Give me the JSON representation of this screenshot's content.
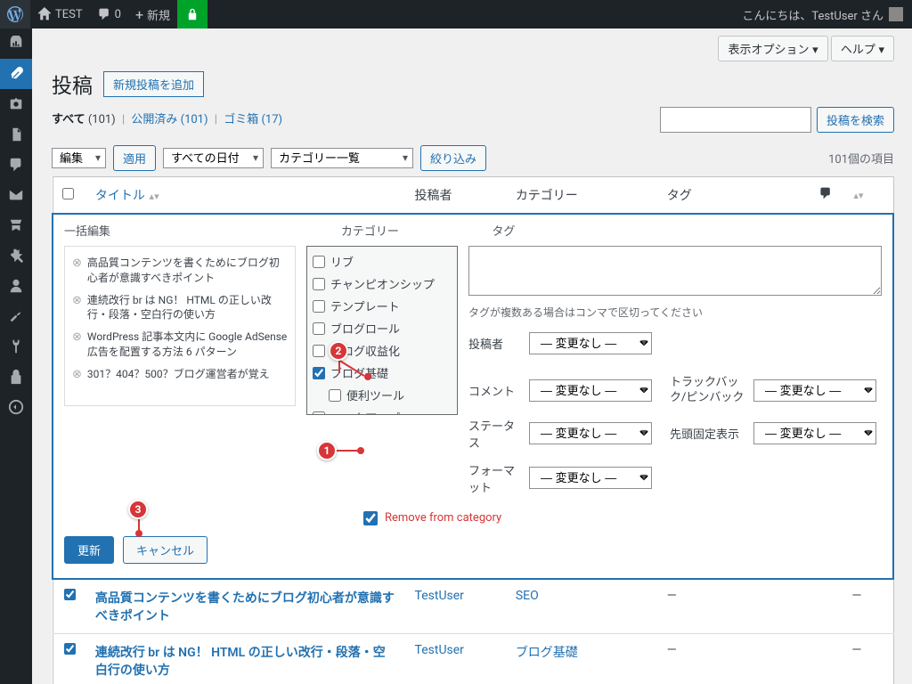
{
  "adminbar": {
    "site_name": "TEST",
    "comment_count": "0",
    "new_label": "新規",
    "greeting": "こんにちは、TestUser さん"
  },
  "top_options": {
    "screen_options": "表示オプション ▾",
    "help": "ヘルプ ▾"
  },
  "header": {
    "page_title": "投稿",
    "add_new": "新規投稿を追加"
  },
  "views": {
    "all_label": "すべて",
    "all_count": "(101)",
    "published_label": "公開済み",
    "published_count": "(101)",
    "trash_label": "ゴミ箱",
    "trash_count": "(17)"
  },
  "search": {
    "placeholder": "",
    "button": "投稿を検索"
  },
  "filters": {
    "bulk_action_select": "編集",
    "apply": "適用",
    "date_select": "すべての日付",
    "cat_select": "カテゴリー一覧",
    "filter": "絞り込み",
    "item_count": "101個の項目"
  },
  "columns": {
    "title": "タイトル",
    "author": "投稿者",
    "categories": "カテゴリー",
    "tags": "タグ"
  },
  "bulk_edit": {
    "header": "一括編集",
    "categories_label": "カテゴリー",
    "tags_label": "タグ",
    "tags_help": "タグが複数ある場合はコンマで区切ってください",
    "author_label": "投稿者",
    "comment_label": "コメント",
    "trackback_label": "トラックバック/ピンバック",
    "status_label": "ステータス",
    "sticky_label": "先頭固定表示",
    "format_label": "フォーマット",
    "no_change": "— 変更なし —",
    "remove_from_category": "Remove from category",
    "update": "更新",
    "cancel": "キャンセル",
    "titles": [
      "高品質コンテンツを書くためにブログ初心者が意識すべきポイント",
      "連続改行 br は NG！ HTML の正しい改行・段落・空白行の使い方",
      "WordPress 記事本文内に Google AdSense 広告を配置する方法 6 パターン",
      "301？404？500？ブログ運営者が覚え"
    ],
    "categories": [
      {
        "label": "リブ",
        "checked": false,
        "indent": false
      },
      {
        "label": "チャンピオンシップ",
        "checked": false,
        "indent": false
      },
      {
        "label": "テンプレート",
        "checked": false,
        "indent": false
      },
      {
        "label": "ブログロール",
        "checked": false,
        "indent": false
      },
      {
        "label": "ブログ収益化",
        "checked": false,
        "indent": false
      },
      {
        "label": "ブログ基礎",
        "checked": true,
        "indent": false
      },
      {
        "label": "便利ツール",
        "checked": false,
        "indent": true
      },
      {
        "label": "マークアップ",
        "checked": false,
        "indent": false
      }
    ]
  },
  "rows": [
    {
      "title": "高品質コンテンツを書くためにブログ初心者が意識すべきポイント",
      "author": "TestUser",
      "category": "SEO",
      "tags": "—",
      "date": "—"
    },
    {
      "title": "連続改行 br は NG！ HTML の正しい改行・段落・空白行の使い方",
      "author": "TestUser",
      "category": "ブログ基礎",
      "tags": "—",
      "date": "—"
    }
  ],
  "annotations": {
    "a1": "1",
    "a2": "2",
    "a3": "3"
  }
}
